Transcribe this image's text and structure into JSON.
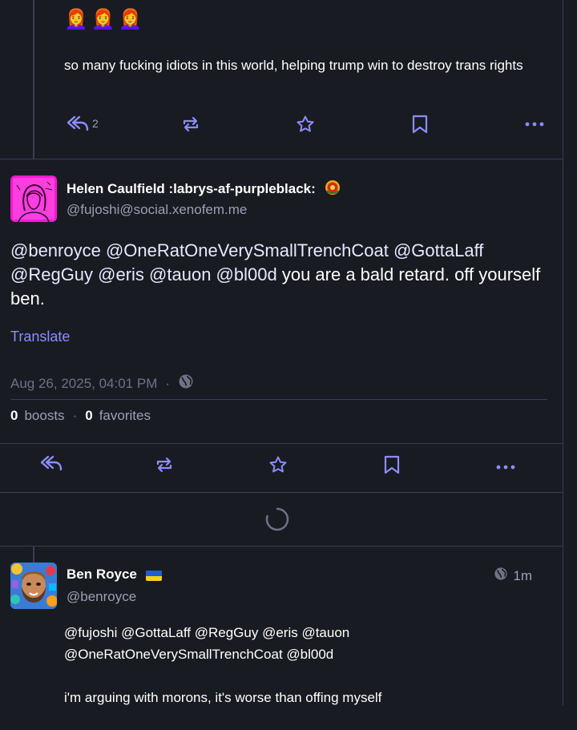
{
  "post1": {
    "emoji": "👩‍🦰👩‍🦰👩‍🦰",
    "text": "so many fucking idiots in this world, helping trump win to destroy trans rights",
    "reply_count": "2"
  },
  "focused": {
    "display_name": "Helen Caulfield :labrys-af-purpleblack:",
    "handle": "@fujoshi@social.xenofem.me",
    "mentions": "@benroyce @OneRatOneVerySmallTrenchCoat @GottaLaff @RegGuy @eris @tauon @bl00d",
    "body": " you are a bald retard. off yourself ben.",
    "translate_label": "Translate",
    "timestamp": "Aug 26, 2025, 04:01 PM",
    "separator": "·",
    "boosts_count": "0",
    "boosts_label": "boosts",
    "favorites_count": "0",
    "favorites_label": "favorites"
  },
  "reply": {
    "display_name": "Ben Royce",
    "handle": "@benroyce",
    "time": "1m",
    "mentions_line": "@fujoshi @GottaLaff @RegGuy @eris @tauon @OneRatOneVerySmallTrenchCoat @bl00d",
    "text": "i'm arguing with morons, it's worse than offing myself"
  },
  "icons": {
    "reply": "reply-all-icon",
    "boost": "boost-icon",
    "favorite": "star-icon",
    "bookmark": "bookmark-icon",
    "more": "more-icon",
    "visibility": "globe-icon"
  },
  "colors": {
    "background": "#191b22",
    "accent": "#8c8dff",
    "border": "#393f4f",
    "muted": "#9c9fb3"
  }
}
